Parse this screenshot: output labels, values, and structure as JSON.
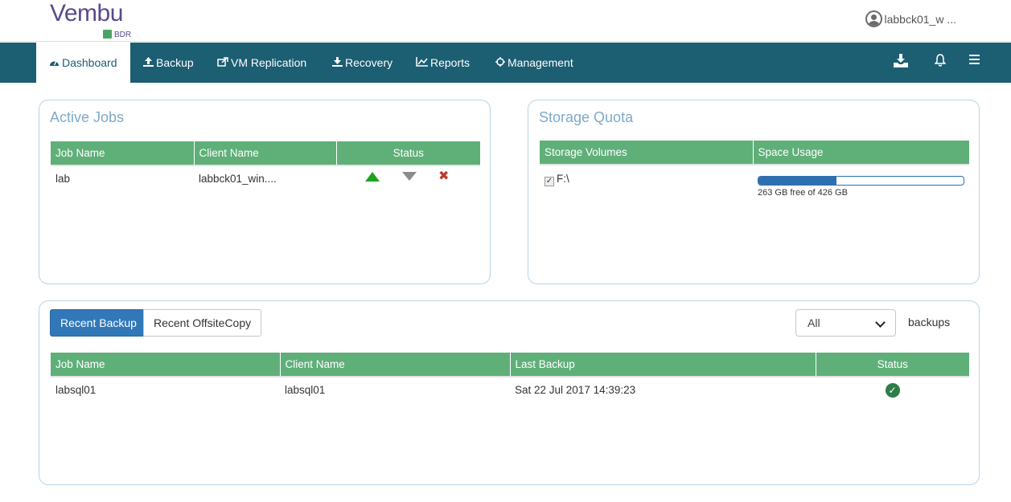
{
  "header": {
    "logo_word": "Vembu",
    "logo_sub": "BDR",
    "user_label": "labbck01_w ..."
  },
  "nav": {
    "items": [
      {
        "label": "Dashboard",
        "icon": "dashboard-icon"
      },
      {
        "label": "Backup",
        "icon": "upload-icon"
      },
      {
        "label": "VM Replication",
        "icon": "share-icon"
      },
      {
        "label": "Recovery",
        "icon": "download-icon"
      },
      {
        "label": "Reports",
        "icon": "chart-line-icon"
      },
      {
        "label": "Management",
        "icon": "crosshair-icon"
      }
    ],
    "right_icons": [
      "download-tray-icon",
      "bell-icon",
      "hamburger-menu-icon"
    ]
  },
  "active_jobs": {
    "title": "Active Jobs",
    "columns": [
      "Job Name",
      "Client Name",
      "Status"
    ],
    "rows": [
      {
        "job_name": "lab",
        "client_name": "labbck01_win...."
      }
    ]
  },
  "storage_quota": {
    "title": "Storage Quota",
    "columns": [
      "Storage Volumes",
      "Space Usage"
    ],
    "rows": [
      {
        "volume": "F:\\",
        "checked": true,
        "used_fraction": 0.38,
        "usage_text": "263 GB free of 426 GB"
      }
    ]
  },
  "recent": {
    "tabs": [
      "Recent Backup",
      "Recent OffsiteCopy"
    ],
    "active_tab": 0,
    "filter_value": "All",
    "filter_suffix": "backups",
    "columns": [
      "Job Name",
      "Client Name",
      "Last Backup",
      "Status"
    ],
    "rows": [
      {
        "job_name": "labsql01",
        "client_name": "labsql01",
        "last_backup": "Sat 22 Jul 2017 14:39:23",
        "status": "success"
      }
    ]
  },
  "colors": {
    "nav_bg": "#1c5e72",
    "table_header": "#5faf79",
    "panel_title": "#7fa9c9",
    "primary_button": "#3278b9",
    "success": "#2e7d46"
  }
}
